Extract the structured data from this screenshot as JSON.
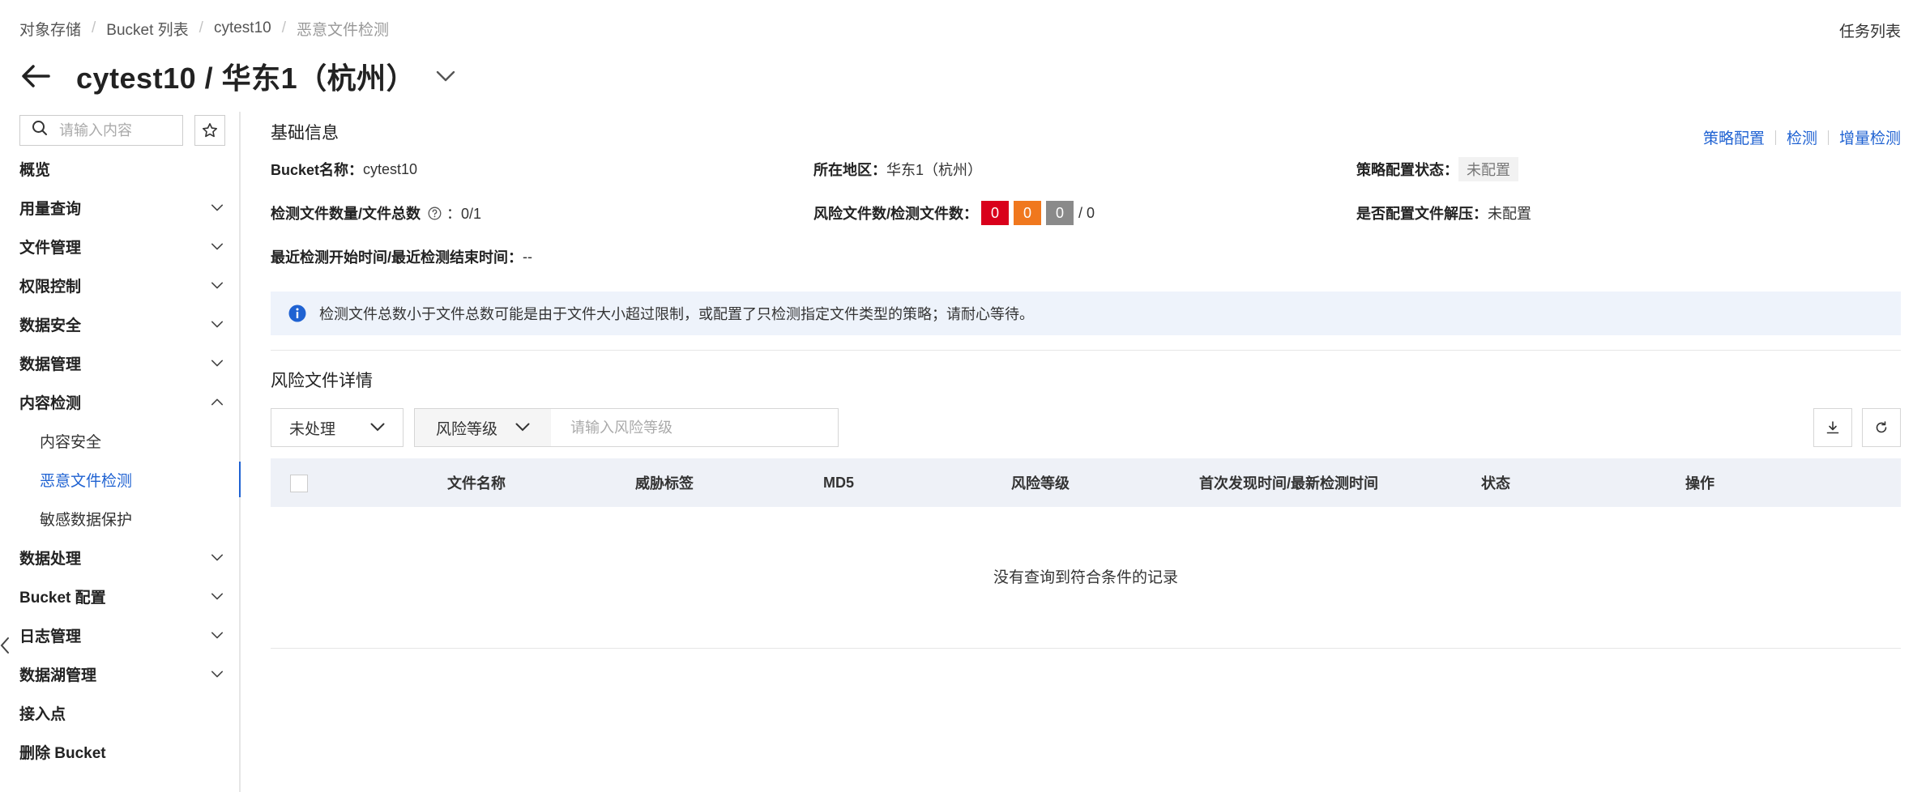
{
  "breadcrumb": [
    "对象存储",
    "Bucket 列表",
    "cytest10",
    "恶意文件检测"
  ],
  "task_list": "任务列表",
  "page_title": "cytest10 / 华东1（杭州）",
  "sidebar": {
    "search_placeholder": "请输入内容",
    "items": [
      {
        "label": "概览",
        "chevron": ""
      },
      {
        "label": "用量查询",
        "chevron": "down"
      },
      {
        "label": "文件管理",
        "chevron": "down"
      },
      {
        "label": "权限控制",
        "chevron": "down"
      },
      {
        "label": "数据安全",
        "chevron": "down"
      },
      {
        "label": "数据管理",
        "chevron": "down"
      },
      {
        "label": "内容检测",
        "chevron": "up"
      },
      {
        "label": "内容安全",
        "sub": true
      },
      {
        "label": "恶意文件检测",
        "sub": true,
        "active": true
      },
      {
        "label": "敏感数据保护",
        "sub": true
      },
      {
        "label": "数据处理",
        "chevron": "down"
      },
      {
        "label": "Bucket 配置",
        "chevron": "down"
      },
      {
        "label": "日志管理",
        "chevron": "down"
      },
      {
        "label": "数据湖管理",
        "chevron": "down"
      },
      {
        "label": "接入点",
        "chevron": ""
      },
      {
        "label": "删除 Bucket",
        "chevron": ""
      }
    ]
  },
  "basic": {
    "title": "基础信息",
    "actions": [
      "策略配置",
      "检测",
      "增量检测"
    ],
    "bucket_label": "Bucket名称：",
    "bucket_value": "cytest10",
    "region_label": "所在地区：",
    "region_value": "华东1（杭州）",
    "policy_label": "策略配置状态：",
    "policy_value": "未配置",
    "count_label": "检测文件数量/文件总数",
    "count_value": "：0/1",
    "risk_label": "风险文件数/检测文件数：",
    "risk_high": "0",
    "risk_mid": "0",
    "risk_low": "0",
    "risk_total": "/ 0",
    "unzip_label": "是否配置文件解压：",
    "unzip_value": "未配置",
    "time_label": "最近检测开始时间/最近检测结束时间：",
    "time_value": "--"
  },
  "notice": "检测文件总数小于文件总数可能是由于文件大小超过限制，或配置了只检测指定文件类型的策略；请耐心等待。",
  "risk": {
    "title": "风险文件详情",
    "status_filter": "未处理",
    "level_select": "风险等级",
    "level_placeholder": "请输入风险等级",
    "columns": [
      "文件名称",
      "威胁标签",
      "MD5",
      "风险等级",
      "首次发现时间/最新检测时间",
      "状态",
      "操作"
    ],
    "empty": "没有查询到符合条件的记录"
  },
  "colors": {
    "accent": "#1f62d2",
    "high": "#d9001b",
    "mid": "#f0781e",
    "low": "#8a8a8a"
  }
}
